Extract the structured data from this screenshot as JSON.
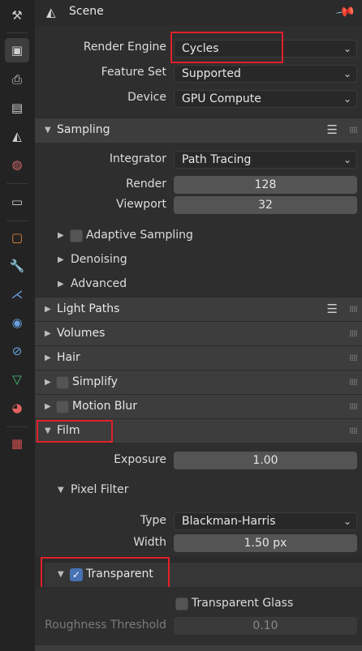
{
  "header": {
    "title": "Scene"
  },
  "render_engine": {
    "label": "Render Engine",
    "value": "Cycles"
  },
  "feature_set": {
    "label": "Feature Set",
    "value": "Supported"
  },
  "device": {
    "label": "Device",
    "value": "GPU Compute"
  },
  "sampling": {
    "title": "Sampling",
    "integrator": {
      "label": "Integrator",
      "value": "Path Tracing"
    },
    "render": {
      "label": "Render",
      "value": "128"
    },
    "viewport": {
      "label": "Viewport",
      "value": "32"
    },
    "adaptive": "Adaptive Sampling",
    "denoising": "Denoising",
    "advanced": "Advanced"
  },
  "panels": {
    "light_paths": "Light Paths",
    "volumes": "Volumes",
    "hair": "Hair",
    "simplify": "Simplify",
    "motion_blur": "Motion Blur",
    "film": "Film"
  },
  "film": {
    "exposure": {
      "label": "Exposure",
      "value": "1.00"
    },
    "pixel_filter": {
      "title": "Pixel Filter",
      "type": {
        "label": "Type",
        "value": "Blackman-Harris"
      },
      "width": {
        "label": "Width",
        "value": "1.50 px"
      }
    },
    "transparent": {
      "title": "Transparent",
      "checked": true
    },
    "transparent_glass": "Transparent Glass",
    "roughness": {
      "label": "Roughness Threshold",
      "value": "0.10"
    }
  },
  "colors": {
    "highlight": "#e0202a",
    "accent": "#4772b3"
  }
}
